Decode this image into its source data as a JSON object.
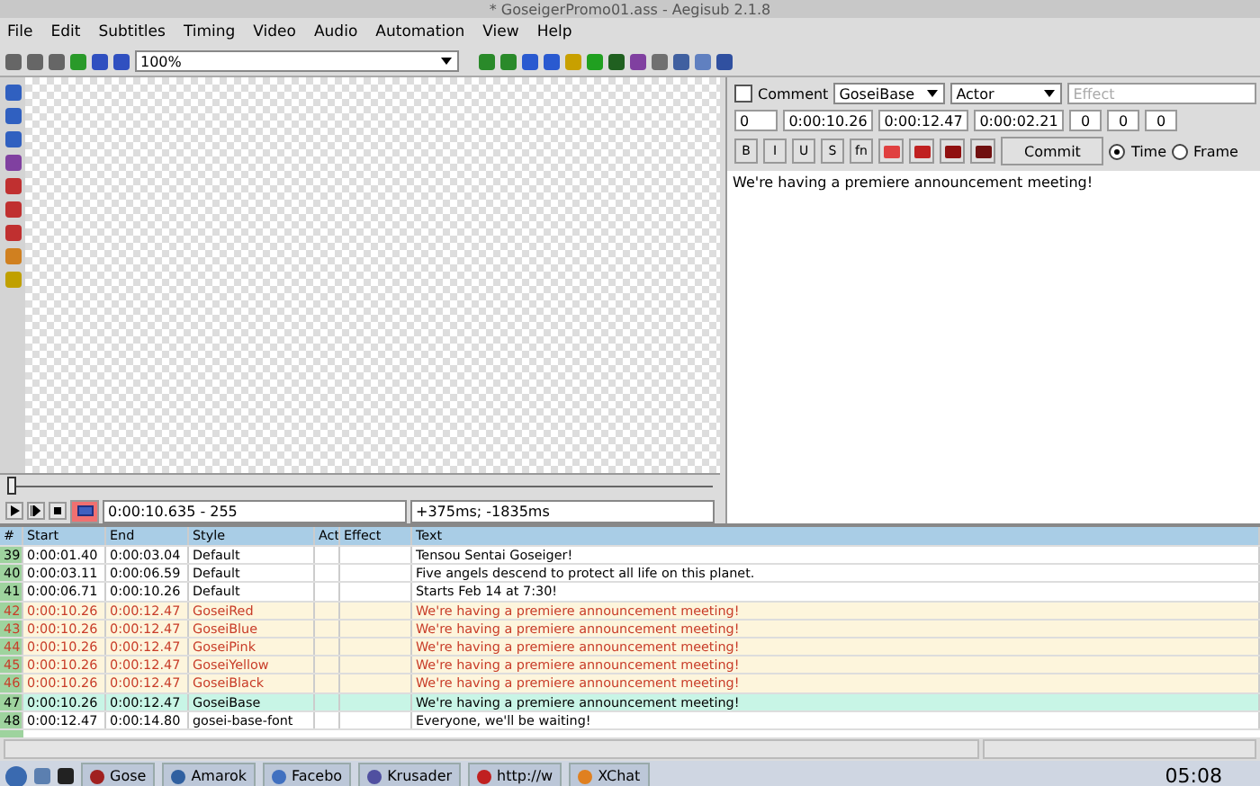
{
  "window": {
    "title": "* GoseigerPromo01.ass - Aegisub 2.1.8"
  },
  "menu": [
    "File",
    "Edit",
    "Subtitles",
    "Timing",
    "Video",
    "Audio",
    "Automation",
    "View",
    "Help"
  ],
  "toolbar": {
    "zoom": "100%"
  },
  "video": {
    "slider": {
      "level": 0.0
    },
    "time": "0:00:10.635 - 255",
    "offset": "+375ms; -1835ms",
    "autoscroll": true
  },
  "editor": {
    "comment": {
      "label": "Comment",
      "checked": false
    },
    "style": "GoseiBase",
    "actor": "Actor",
    "effect_placeholder": "Effect",
    "layer": "0",
    "start": "0:00:10.26",
    "end": "0:00:12.47",
    "duration": "0:00:02.21",
    "margins": [
      "0",
      "0",
      "0"
    ],
    "format_buttons": [
      "B",
      "I",
      "U",
      "S",
      "fn"
    ],
    "commit": "Commit",
    "radios": [
      {
        "label": "Time",
        "selected": true
      },
      {
        "label": "Frame",
        "selected": false
      }
    ],
    "text": "We're having a premiere announcement meeting!"
  },
  "grid": {
    "columns": [
      "#",
      "Start",
      "End",
      "Style",
      "Act",
      "Effect",
      "Text"
    ],
    "rows": [
      {
        "num": "39",
        "start": "0:00:01.40",
        "end": "0:00:03.04",
        "style": "Default",
        "text": "Tensou Sentai Goseiger!",
        "kind": "normal",
        "selected": false
      },
      {
        "num": "40",
        "start": "0:00:03.11",
        "end": "0:00:06.59",
        "style": "Default",
        "text": "Five angels descend to protect all life on this planet.",
        "kind": "normal",
        "selected": false
      },
      {
        "num": "41",
        "start": "0:00:06.71",
        "end": "0:00:10.26",
        "style": "Default",
        "text": "Starts Feb 14 at 7:30!",
        "kind": "normal",
        "selected": false
      },
      {
        "num": "42",
        "start": "0:00:10.26",
        "end": "0:00:12.47",
        "style": "GoseiRed",
        "text": "We're having a premiere announcement meeting!",
        "kind": "overlap",
        "selected": false
      },
      {
        "num": "43",
        "start": "0:00:10.26",
        "end": "0:00:12.47",
        "style": "GoseiBlue",
        "text": "We're having a premiere announcement meeting!",
        "kind": "overlap",
        "selected": false
      },
      {
        "num": "44",
        "start": "0:00:10.26",
        "end": "0:00:12.47",
        "style": "GoseiPink",
        "text": "We're having a premiere announcement meeting!",
        "kind": "overlap",
        "selected": false
      },
      {
        "num": "45",
        "start": "0:00:10.26",
        "end": "0:00:12.47",
        "style": "GoseiYellow",
        "text": "We're having a premiere announcement meeting!",
        "kind": "overlap",
        "selected": false
      },
      {
        "num": "46",
        "start": "0:00:10.26",
        "end": "0:00:12.47",
        "style": "GoseiBlack",
        "text": "We're having a premiere announcement meeting!",
        "kind": "overlap",
        "selected": false
      },
      {
        "num": "47",
        "start": "0:00:10.26",
        "end": "0:00:12.47",
        "style": "GoseiBase",
        "text": "We're having a premiere announcement meeting!",
        "kind": "normal",
        "selected": true
      },
      {
        "num": "48",
        "start": "0:00:12.47",
        "end": "0:00:14.80",
        "style": "gosei-base-font",
        "text": "Everyone, we'll be waiting!",
        "kind": "normal",
        "selected": false
      }
    ]
  },
  "taskbar": {
    "tasks": [
      "Gose",
      "Amarok",
      "Facebo",
      "Krusader",
      "http://w",
      "XChat"
    ],
    "clock": "05:08"
  }
}
